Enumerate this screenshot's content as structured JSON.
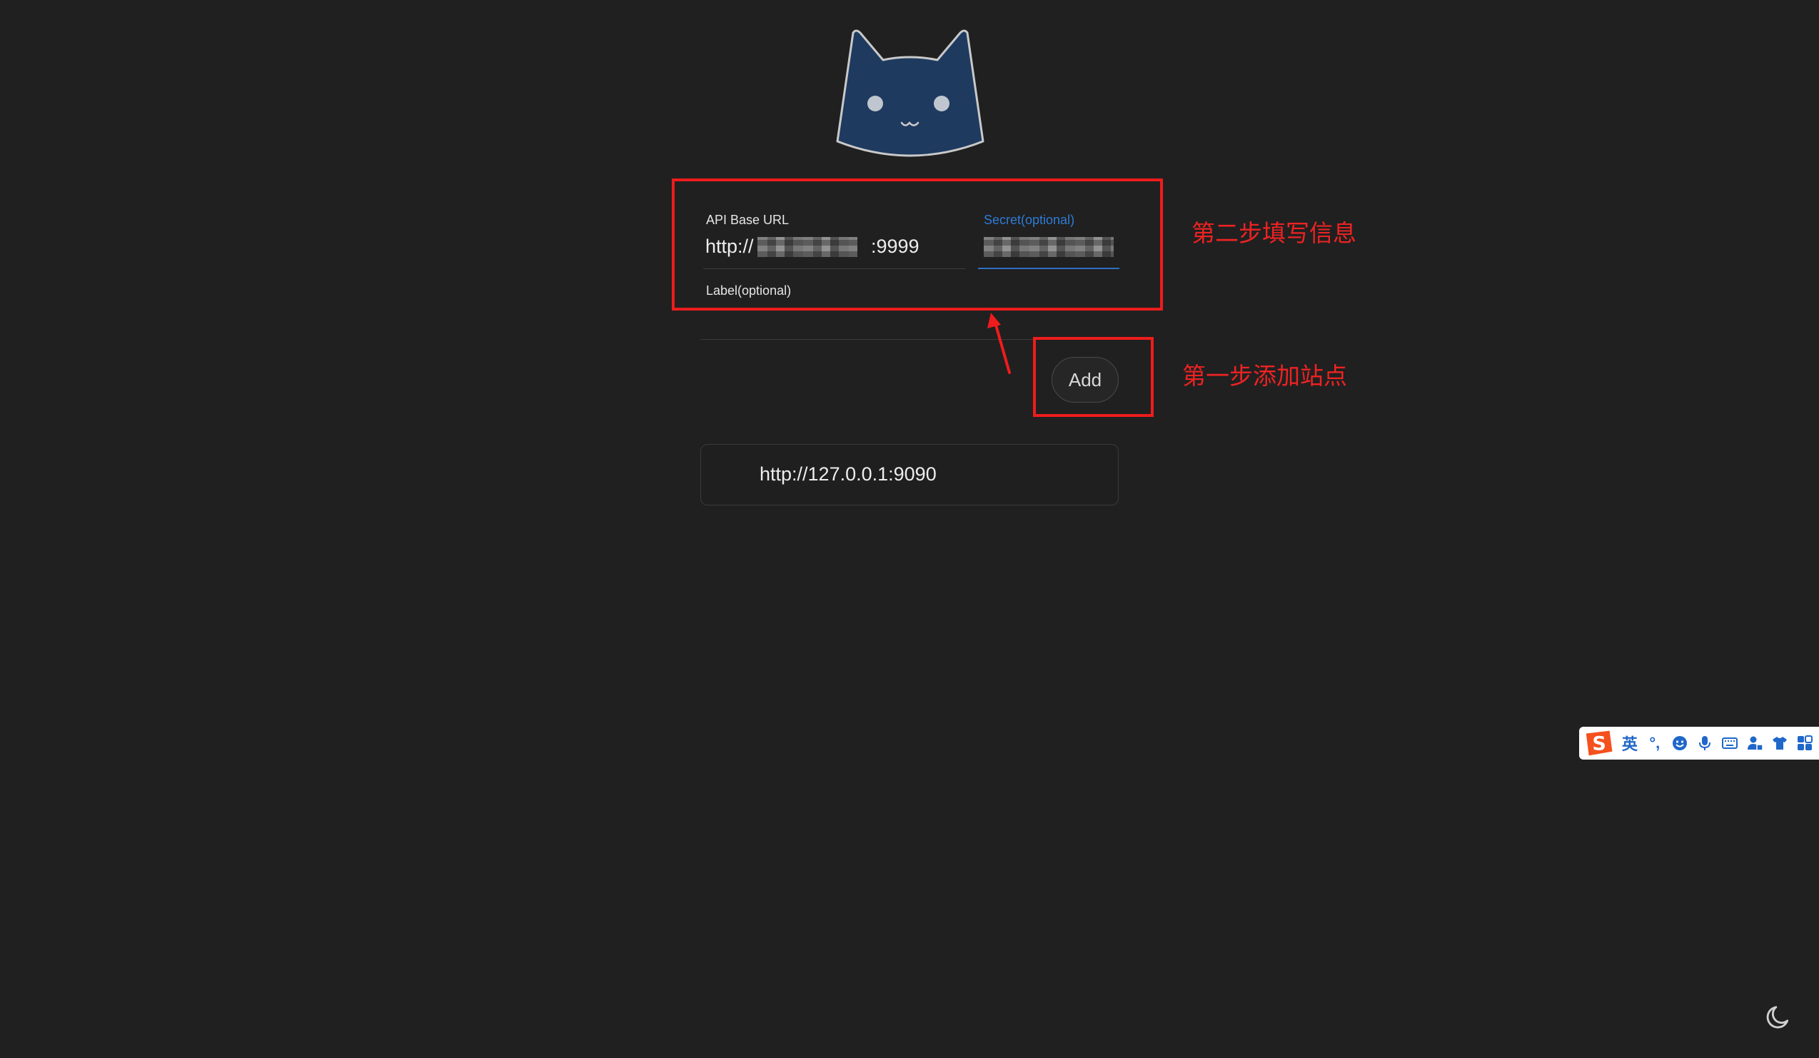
{
  "app": {
    "logo": "cat-logo"
  },
  "form": {
    "api_base_url_label": "API Base URL",
    "api_base_url_value": "http://",
    "api_base_url_port": ":9999",
    "secret_label": "Secret(optional)",
    "label_label": "Label(optional)",
    "add_button": "Add"
  },
  "servers": [
    {
      "url": "http://127.0.0.1:9090"
    }
  ],
  "annotations": {
    "step2": "第二步填写信息",
    "step1": "第一步添加站点"
  },
  "ime_toolbar": {
    "logo": "sogou-logo",
    "mode_label": "英",
    "punct_label": "°,",
    "icons": [
      "emoji-icon",
      "microphone-icon",
      "keyboard-icon",
      "user-icon",
      "shirt-icon",
      "grid-icon"
    ]
  },
  "colors": {
    "background": "#202020",
    "accent": "#2f7bd6",
    "annotation_red": "#ee1c1c",
    "logo_fill": "#1f3a5f"
  },
  "theme_toggle_icon": "moon-icon"
}
